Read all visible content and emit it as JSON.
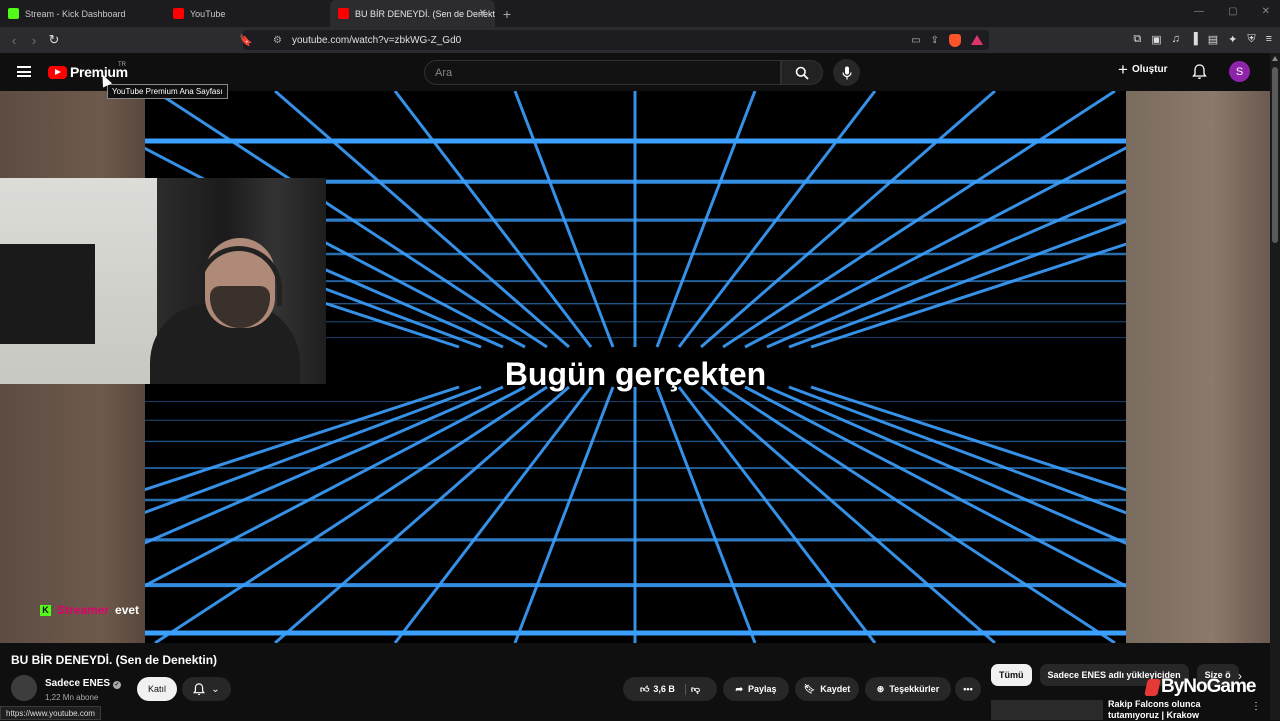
{
  "browser": {
    "tabs": [
      {
        "label": "Stream - Kick Dashboard",
        "favicon_color": "#53fc18"
      },
      {
        "label": "YouTube",
        "favicon_color": "#ff0000"
      },
      {
        "label": "BU BİR DENEYDİ. (Sen de Denekt",
        "favicon_color": "#ff0000"
      }
    ],
    "new_tab": "+",
    "url": "youtube.com/watch?v=zbkWG-Z_Gd0"
  },
  "header": {
    "logo_text": "Premium",
    "region": "TR",
    "logo_tooltip": "YouTube Premium Ana Sayfası",
    "search_placeholder": "Ara",
    "create_label": "Oluştur",
    "avatar_letter": "S"
  },
  "player": {
    "caption": "Bugün gerçekten"
  },
  "stream_chat": {
    "username": "Streamer",
    "message": "evet"
  },
  "video": {
    "title": "BU BİR DENEYDİ. (Sen de Denektin)",
    "channel_name": "Sadece ENES",
    "subscribers": "1,22 Mn abone",
    "join_label": "Katıl",
    "likes": "3,6 B",
    "share_label": "Paylaş",
    "save_label": "Kaydet",
    "thanks_label": "Teşekkürler"
  },
  "recommendations": {
    "chips": [
      "Tümü",
      "Sadece ENES adlı yükleyiciden",
      "Size ö"
    ],
    "first_title": "Rakip Falcons olunca tutamıyoruz | Krakow"
  },
  "watermark": "ByNoGame",
  "status_bar_url": "https://www.youtube.com",
  "colors": {
    "accent_red": "#ff0000",
    "kick_green": "#53fc18",
    "grid_blue": "#3ba0ff",
    "avatar_purple": "#8e24aa"
  }
}
